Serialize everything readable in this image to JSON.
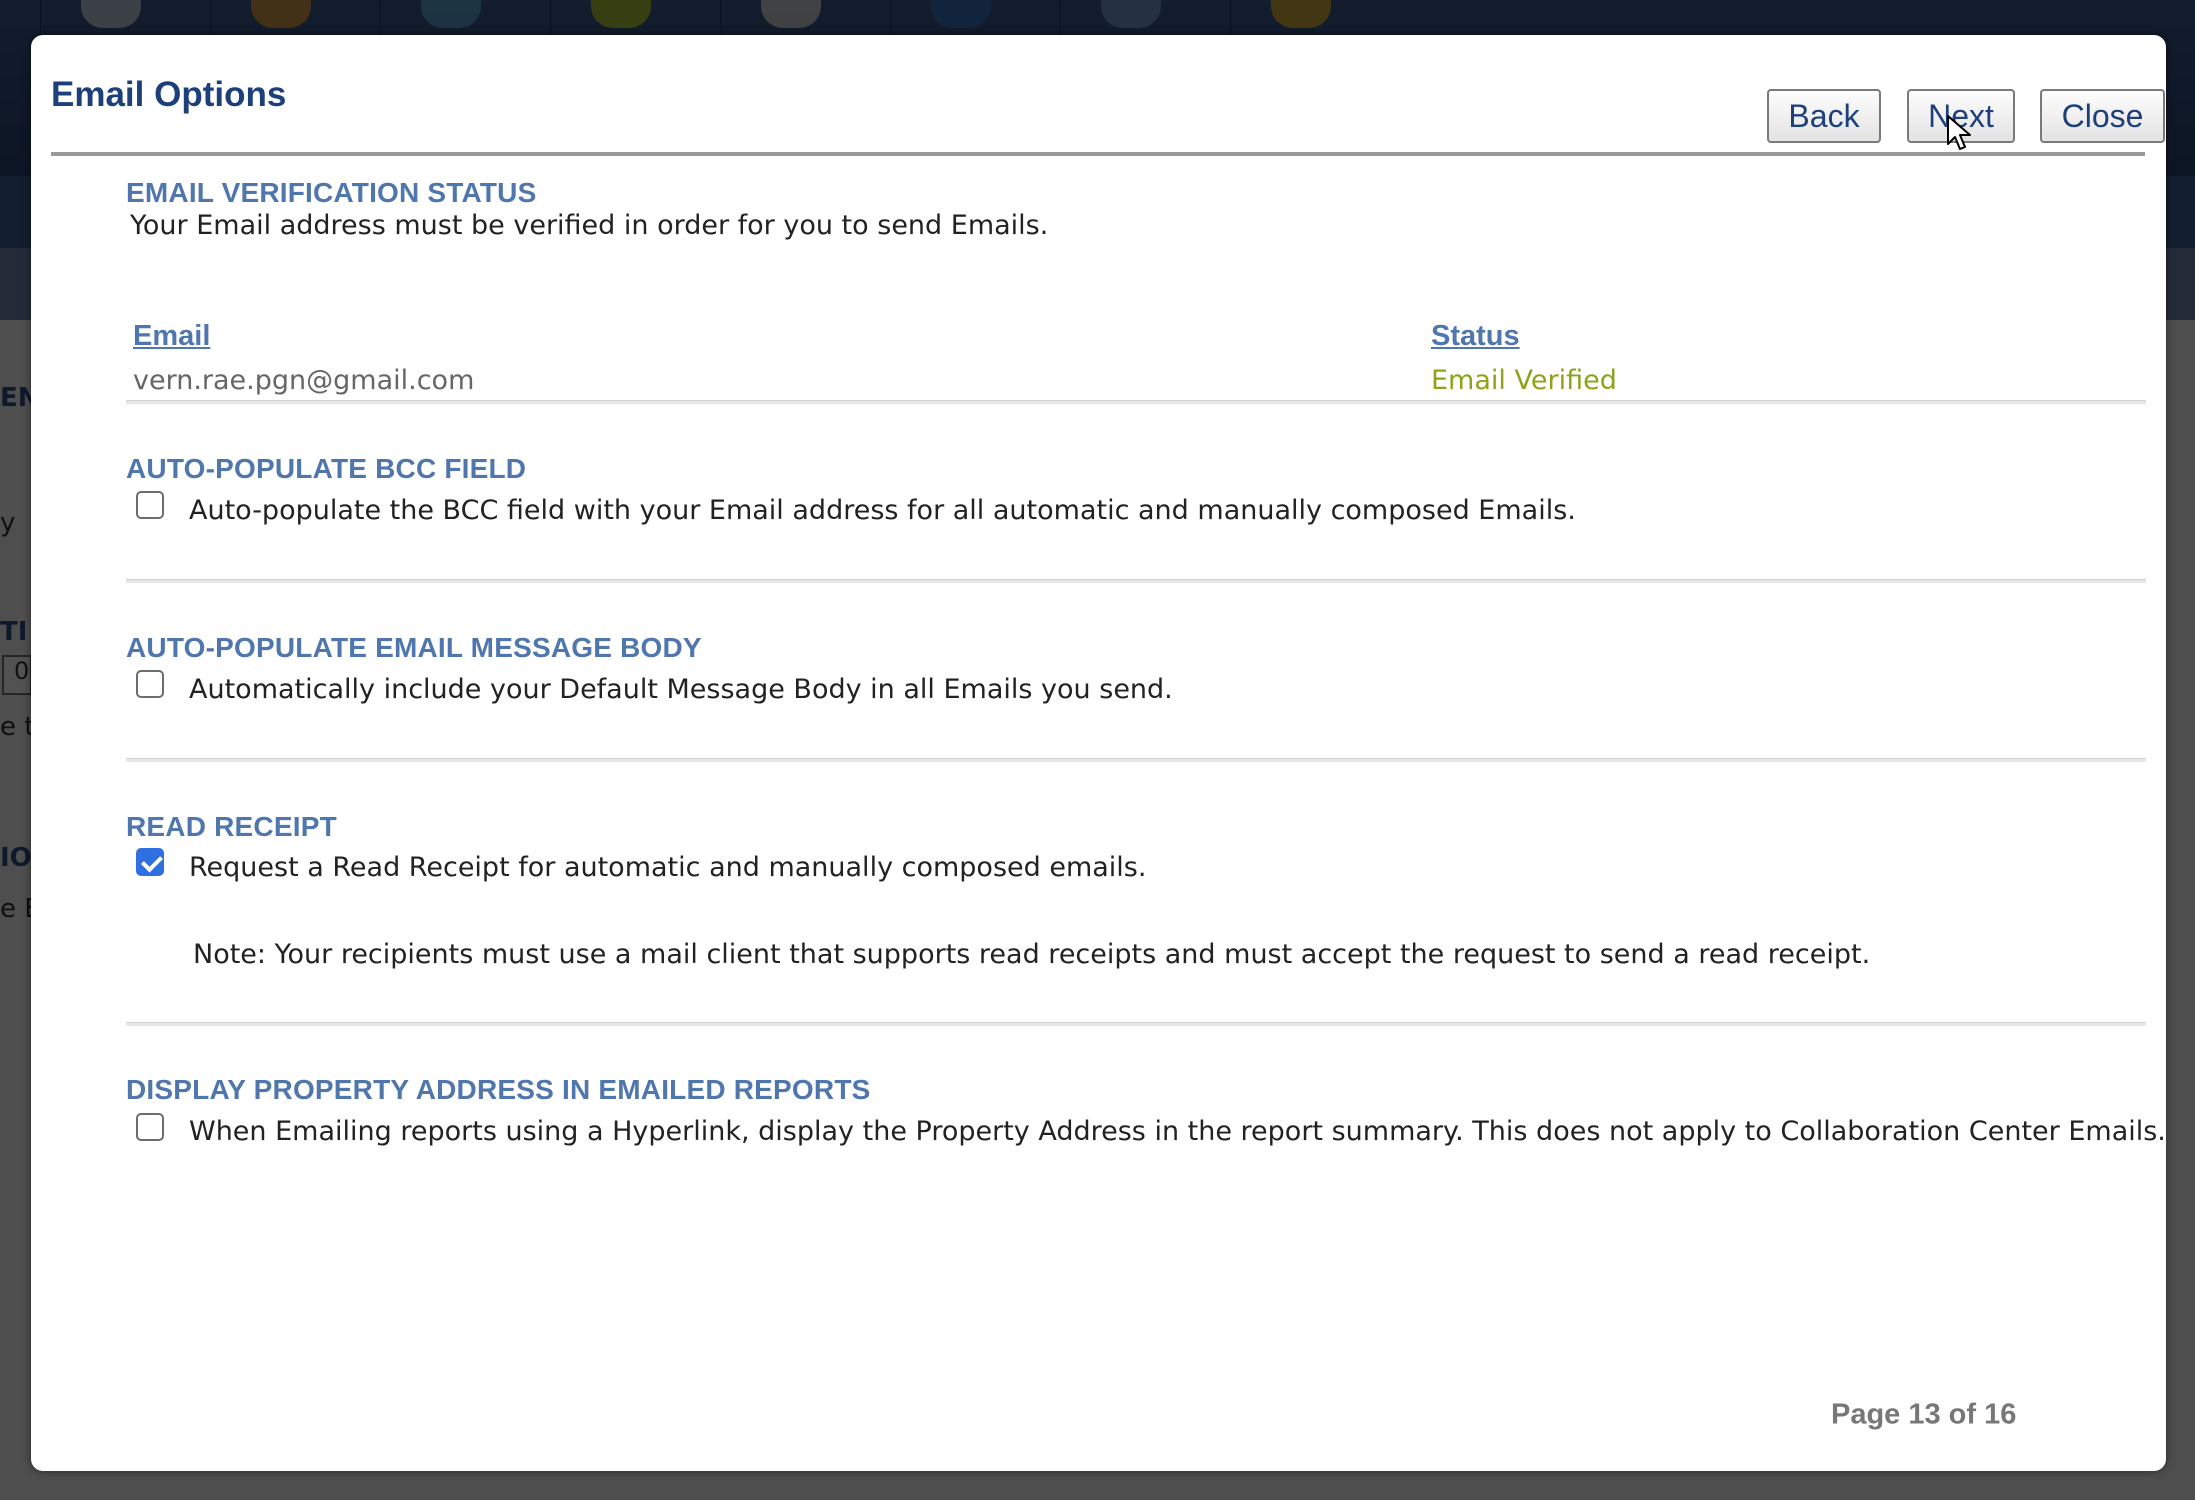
{
  "dialog": {
    "title": "Email Options",
    "buttons": {
      "back": "Back",
      "next": "Next",
      "close": "Close"
    },
    "page_indicator": "Page 13 of 16"
  },
  "verification": {
    "title": "EMAIL VERIFICATION STATUS",
    "description": "Your Email address must be verified in order for you to send Emails.",
    "columns": {
      "email": "Email",
      "status": "Status"
    },
    "row": {
      "email": "vern.rae.pgn@gmail.com",
      "status": "Email Verified"
    },
    "status_color": "#8aa51a"
  },
  "bcc": {
    "title": "AUTO-POPULATE BCC FIELD",
    "label": "Auto-populate the BCC field with your Email address for all automatic and manually composed Emails.",
    "checked": false
  },
  "message_body": {
    "title": "AUTO-POPULATE EMAIL MESSAGE BODY",
    "label": "Automatically include your Default Message Body in all Emails you send.",
    "checked": false
  },
  "read_receipt": {
    "title": "READ RECEIPT",
    "label": "Request a Read Receipt for automatic and manually composed emails.",
    "checked": true,
    "note": "Note: Your recipients must use a mail client that supports read receipts and must accept the request to send a read receipt."
  },
  "property_address": {
    "title": "DISPLAY PROPERTY ADDRESS IN EMAILED REPORTS",
    "label": "When Emailing reports using a Hyperlink, display the Property Address in the report summary. This does not apply to Collaboration Center Emails.",
    "checked": false
  },
  "background": {
    "fragments": [
      "EN",
      "y",
      "TI",
      "0",
      "e t",
      "IO",
      "e E"
    ]
  },
  "colors": {
    "title": "#1d3f7a",
    "section_heading": "#4f76ad",
    "checkbox_checked": "#2f6fe0"
  }
}
